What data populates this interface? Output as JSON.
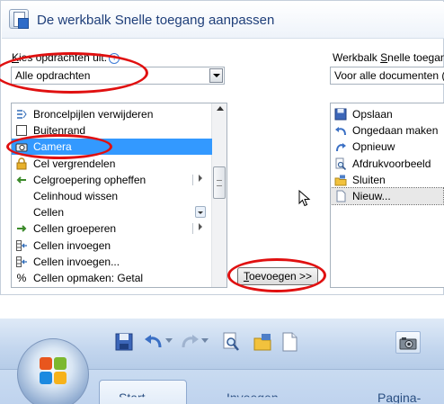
{
  "dialog": {
    "title": "De werkbalk Snelle toegang aanpassen",
    "choose_label_mnemonic": "K",
    "choose_label_rest": "ies opdrachten uit:",
    "info_icon": "i",
    "commands_combo_value": "Alle opdrachten",
    "commands_list": [
      {
        "label": "Broncelpijlen verwijderen",
        "icon": "remove-arrows-icon"
      },
      {
        "label": "Buitenrand",
        "icon": "border-icon"
      },
      {
        "label": "Camera",
        "icon": "camera-icon",
        "selected": true
      },
      {
        "label": "Cel vergrendelen",
        "icon": "lock-icon"
      },
      {
        "label": "Celgroepering opheffen",
        "icon": "ungroup-icon",
        "submenu": true
      },
      {
        "label": "Celinhoud wissen",
        "icon": ""
      },
      {
        "label": "Cellen",
        "icon": "",
        "dropdown": true
      },
      {
        "label": "Cellen groeperen",
        "icon": "group-icon",
        "submenu": true
      },
      {
        "label": "Cellen invoegen",
        "icon": "insert-cells-icon"
      },
      {
        "label": "Cellen invoegen...",
        "icon": "insert-cells-icon"
      },
      {
        "label": "Cellen opmaken: Getal",
        "icon": "percent-icon"
      }
    ],
    "add_button_mnemonic": "T",
    "add_button_rest": "oevoegen >>",
    "toolbar_label_a": "Werkbalk ",
    "toolbar_label_mnemonic": "S",
    "toolbar_label_b": "nelle toegan",
    "toolbar_combo_value": "Voor alle documenten (",
    "toolbar_list": [
      {
        "label": "Opslaan",
        "icon": "save-icon"
      },
      {
        "label": "Ongedaan maken",
        "icon": "undo-icon"
      },
      {
        "label": "Opnieuw",
        "icon": "redo-icon"
      },
      {
        "label": "Afdrukvoorbeeld",
        "icon": "print-preview-icon"
      },
      {
        "label": "Sluiten",
        "icon": "close-folder-icon"
      },
      {
        "label": "Nieuw...",
        "icon": "new-document-icon",
        "selected": true
      }
    ]
  },
  "ribbon": {
    "tab_label": "Start",
    "text_2": "Invoegen",
    "text_3": "Pagina-indeling",
    "quick_access_icons": [
      "save-icon",
      "undo-icon",
      "redo-icon",
      "print-preview-icon",
      "close-folder-icon",
      "new-document-icon",
      "camera-icon"
    ]
  },
  "colors": {
    "highlight": "#e01010",
    "selection": "#3399ff",
    "ribbon_blue": "#c3d6ee"
  }
}
